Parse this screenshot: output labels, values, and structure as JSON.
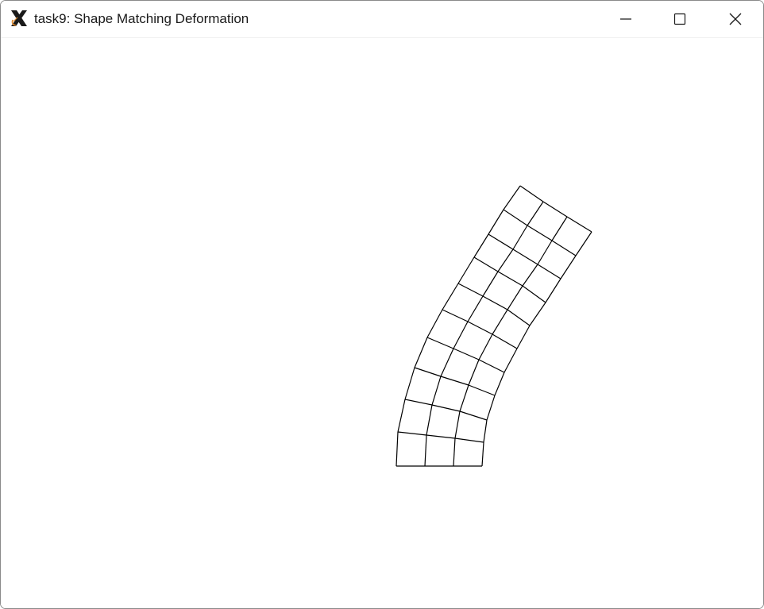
{
  "window": {
    "title": "task9: Shape Matching Deformation",
    "app_icon": "x-window-system-icon",
    "controls": {
      "minimize_icon": "minimize-icon",
      "maximize_icon": "maximize-icon",
      "close_icon": "close-icon"
    }
  },
  "canvas": {
    "background": "#ffffff",
    "line_color": "#000000",
    "mesh": {
      "description_free": true,
      "columns": 4,
      "rows": 11
    }
  }
}
